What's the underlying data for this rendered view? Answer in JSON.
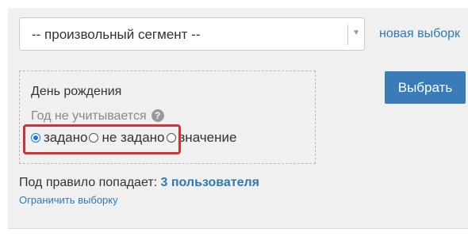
{
  "segment_select": {
    "value": "-- произвольный сегмент --",
    "arrow_icon": "triangle-down-icon"
  },
  "new_selection_link": "новая выборк",
  "filter": {
    "title": "День рождения",
    "year_note": "Год не учитывается",
    "help_icon": "?",
    "options": [
      {
        "label": "задано",
        "checked": true
      },
      {
        "label": "не задано",
        "checked": false
      },
      {
        "label": "значение",
        "checked": false
      }
    ]
  },
  "select_button": "Выбрать",
  "result": {
    "prefix": "Под правило попадает:",
    "count": "3 пользователя"
  },
  "limit_link": "Ограничить выборку",
  "colors": {
    "accent": "#2f7ab5",
    "button": "#3a7cb8",
    "highlight": "#d82f2f",
    "radio_checked": "#1a73e8"
  }
}
